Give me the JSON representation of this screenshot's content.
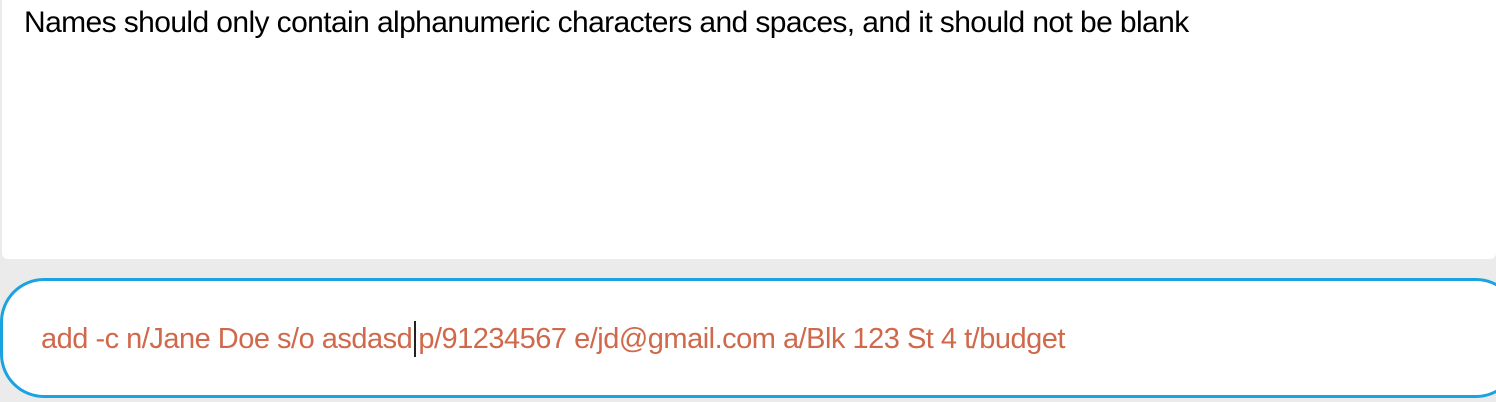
{
  "result_display": {
    "message": "Names should only contain alphanumeric characters and spaces, and it should not be blank"
  },
  "command_box": {
    "text_before_caret": "add -c n/Jane Doe s/o asdasd",
    "text_after_caret": "p/91234567 e/jd@gmail.com a/Blk 123 St 4 t/budget",
    "text_color": "#d0694c",
    "focus_border_color": "#1aa3e0"
  }
}
